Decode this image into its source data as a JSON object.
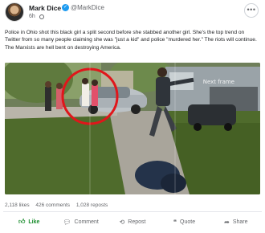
{
  "author": {
    "name": "Mark Dice",
    "handle": "@MarkDice",
    "time": "6h",
    "verified_mark": "✓"
  },
  "post": {
    "text": "Police in Ohio shot this black girl a split second before she stabbed another girl. She's the top trend on Twitter from so many people claiming she was \"just a kid\" and police \"murdered her.\" The riots will continue. The Marxists are hell bent on destroying America.",
    "media_watermark": "Next frame"
  },
  "stats": {
    "likes": "2,118 likes",
    "comments": "426 comments",
    "reposts": "1,028 reposts"
  },
  "actions": {
    "like": "Like",
    "comment": "Comment",
    "repost": "Repost",
    "quote": "Quote",
    "share": "Share"
  },
  "icons": {
    "like": "thumbs-up-icon",
    "comment": "comment-icon",
    "repost": "repost-icon",
    "quote": "quote-icon",
    "share": "share-icon",
    "more": "more-icon"
  },
  "colors": {
    "like_active": "#1a8d2e",
    "verified": "#1d9bf0",
    "highlight_circle": "#e0161b"
  }
}
